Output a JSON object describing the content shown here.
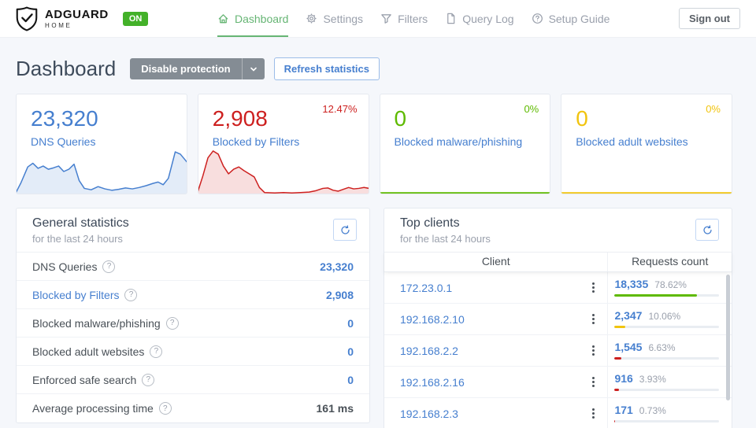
{
  "header": {
    "brand": {
      "name": "ADGUARD",
      "sub": "HOME",
      "status_badge": "ON"
    },
    "nav": [
      {
        "label": "Dashboard",
        "icon": "home-icon",
        "active": true
      },
      {
        "label": "Settings",
        "icon": "gear-icon",
        "active": false
      },
      {
        "label": "Filters",
        "icon": "funnel-icon",
        "active": false
      },
      {
        "label": "Query Log",
        "icon": "file-icon",
        "active": false
      },
      {
        "label": "Setup Guide",
        "icon": "help-icon",
        "active": false
      }
    ],
    "sign_out_label": "Sign out"
  },
  "page": {
    "title": "Dashboard",
    "disable_protection_label": "Disable protection",
    "refresh_statistics_label": "Refresh statistics"
  },
  "colors": {
    "brand_green": "#66b574",
    "badge_green": "#43b129",
    "blue": "#467fcf",
    "red": "#cd201f",
    "green": "#5eba00",
    "yellow": "#f1c40f"
  },
  "icons": {
    "help_glyph": "?"
  },
  "stat_cards": [
    {
      "value": "23,320",
      "label": "DNS Queries",
      "percent": "",
      "color": "#467fcf",
      "sparkline": {
        "type": "area",
        "points": [
          [
            0,
            0.03
          ],
          [
            3,
            0.25
          ],
          [
            7,
            0.6
          ],
          [
            10,
            0.68
          ],
          [
            13,
            0.57
          ],
          [
            16,
            0.62
          ],
          [
            19,
            0.55
          ],
          [
            22,
            0.58
          ],
          [
            25,
            0.62
          ],
          [
            28,
            0.5
          ],
          [
            31,
            0.55
          ],
          [
            34,
            0.66
          ],
          [
            37,
            0.3
          ],
          [
            40,
            0.13
          ],
          [
            44,
            0.1
          ],
          [
            48,
            0.17
          ],
          [
            52,
            0.12
          ],
          [
            56,
            0.09
          ],
          [
            60,
            0.11
          ],
          [
            64,
            0.14
          ],
          [
            68,
            0.12
          ],
          [
            72,
            0.15
          ],
          [
            76,
            0.19
          ],
          [
            80,
            0.24
          ],
          [
            83,
            0.27
          ],
          [
            86,
            0.21
          ],
          [
            89,
            0.35
          ],
          [
            93,
            0.93
          ],
          [
            96,
            0.88
          ],
          [
            100,
            0.7
          ]
        ]
      }
    },
    {
      "value": "2,908",
      "label": "Blocked by Filters",
      "percent": "12.47%",
      "color": "#cd201f",
      "sparkline": {
        "type": "area",
        "points": [
          [
            0,
            0.05
          ],
          [
            3,
            0.4
          ],
          [
            6,
            0.8
          ],
          [
            9,
            0.95
          ],
          [
            12,
            0.88
          ],
          [
            15,
            0.62
          ],
          [
            18,
            0.45
          ],
          [
            21,
            0.55
          ],
          [
            24,
            0.6
          ],
          [
            27,
            0.52
          ],
          [
            30,
            0.45
          ],
          [
            33,
            0.38
          ],
          [
            36,
            0.15
          ],
          [
            39,
            0.04
          ],
          [
            45,
            0.03
          ],
          [
            50,
            0.04
          ],
          [
            55,
            0.03
          ],
          [
            60,
            0.04
          ],
          [
            65,
            0.05
          ],
          [
            69,
            0.08
          ],
          [
            73,
            0.13
          ],
          [
            76,
            0.14
          ],
          [
            79,
            0.09
          ],
          [
            82,
            0.07
          ],
          [
            85,
            0.11
          ],
          [
            88,
            0.15
          ],
          [
            91,
            0.12
          ],
          [
            94,
            0.13
          ],
          [
            97,
            0.15
          ],
          [
            100,
            0.13
          ]
        ]
      }
    },
    {
      "value": "0",
      "label": "Blocked malware/phishing",
      "percent": "0%",
      "color": "#5eba00",
      "sparkline": {
        "type": "line",
        "points": [
          [
            0,
            0.03
          ],
          [
            100,
            0.03
          ]
        ]
      }
    },
    {
      "value": "0",
      "label": "Blocked adult websites",
      "percent": "0%",
      "color": "#f1c40f",
      "sparkline": {
        "type": "line",
        "points": [
          [
            0,
            0.03
          ],
          [
            100,
            0.03
          ]
        ]
      }
    }
  ],
  "general_statistics": {
    "title": "General statistics",
    "subtitle": "for the last 24 hours",
    "rows": [
      {
        "label": "DNS Queries",
        "value": "23,320",
        "label_link": false,
        "value_style": "blue"
      },
      {
        "label": "Blocked by Filters",
        "value": "2,908",
        "label_link": true,
        "value_style": "blue"
      },
      {
        "label": "Blocked malware/phishing",
        "value": "0",
        "label_link": false,
        "value_style": "blue"
      },
      {
        "label": "Blocked adult websites",
        "value": "0",
        "label_link": false,
        "value_style": "blue"
      },
      {
        "label": "Enforced safe search",
        "value": "0",
        "label_link": false,
        "value_style": "blue"
      },
      {
        "label": "Average processing time",
        "value": "161 ms",
        "label_link": false,
        "value_style": "dark"
      }
    ]
  },
  "top_clients": {
    "title": "Top clients",
    "subtitle": "for the last 24 hours",
    "columns": [
      "Client",
      "Requests count"
    ],
    "rows": [
      {
        "client": "172.23.0.1",
        "count": "18,335",
        "percent": "78.62%",
        "bar_value": 78.62,
        "bar_color": "#5eba00"
      },
      {
        "client": "192.168.2.10",
        "count": "2,347",
        "percent": "10.06%",
        "bar_value": 10.06,
        "bar_color": "#f1c40f"
      },
      {
        "client": "192.168.2.2",
        "count": "1,545",
        "percent": "6.63%",
        "bar_value": 6.63,
        "bar_color": "#cd201f"
      },
      {
        "client": "192.168.2.16",
        "count": "916",
        "percent": "3.93%",
        "bar_value": 3.93,
        "bar_color": "#cd201f"
      },
      {
        "client": "192.168.2.3",
        "count": "171",
        "percent": "0.73%",
        "bar_value": 0.73,
        "bar_color": "#cd201f"
      }
    ]
  }
}
